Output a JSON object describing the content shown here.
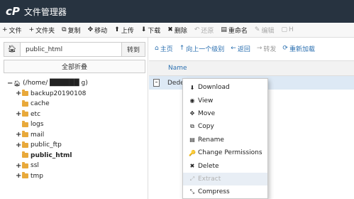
{
  "app": {
    "logo": "cP",
    "title": "文件管理器"
  },
  "toolbar": [
    {
      "icon": "+",
      "label": "文件",
      "disabled": false
    },
    {
      "icon": "+",
      "label": "文件夹",
      "disabled": false
    },
    {
      "icon": "⧉",
      "label": "复制",
      "disabled": false
    },
    {
      "icon": "✥",
      "label": "移动",
      "disabled": false
    },
    {
      "icon": "⬆",
      "label": "上传",
      "disabled": false
    },
    {
      "icon": "⬇",
      "label": "下载",
      "disabled": false
    },
    {
      "icon": "✖",
      "label": "删除",
      "disabled": false
    },
    {
      "icon": "↶",
      "label": "还原",
      "disabled": true
    },
    {
      "icon": "▤",
      "label": "重命名",
      "disabled": false
    },
    {
      "icon": "✎",
      "label": "编辑",
      "disabled": true
    },
    {
      "icon": "▢",
      "label": "H",
      "disabled": true
    }
  ],
  "left": {
    "path_value": "public_html",
    "go_label": "转到",
    "collapse_all": "全部折叠",
    "tree": [
      {
        "pm": "−",
        "label": "(/home/ ██████ g)",
        "home": true,
        "indent": 0,
        "bold": false
      },
      {
        "pm": "+",
        "label": "backup20190108",
        "indent": 1,
        "bold": false
      },
      {
        "pm": "",
        "label": "cache",
        "indent": 1,
        "bold": false
      },
      {
        "pm": "+",
        "label": "etc",
        "indent": 1,
        "bold": false
      },
      {
        "pm": "",
        "label": "logs",
        "indent": 1,
        "bold": false
      },
      {
        "pm": "+",
        "label": "mail",
        "indent": 1,
        "bold": false
      },
      {
        "pm": "+",
        "label": "public_ftp",
        "indent": 1,
        "bold": false
      },
      {
        "pm": "",
        "label": "public_html",
        "indent": 1,
        "bold": true
      },
      {
        "pm": "+",
        "label": "ssl",
        "indent": 1,
        "bold": false
      },
      {
        "pm": "+",
        "label": "tmp",
        "indent": 1,
        "bold": false
      }
    ]
  },
  "right": {
    "nav": [
      {
        "icon": "⌂",
        "label": "主页",
        "disabled": false
      },
      {
        "icon": "↑",
        "label": "向上一个级别",
        "disabled": false
      },
      {
        "icon": "←",
        "label": "返回",
        "disabled": false
      },
      {
        "icon": "→",
        "label": "转发",
        "disabled": true
      },
      {
        "icon": "⟳",
        "label": "重新加载",
        "disabled": false
      }
    ],
    "column_name": "Name",
    "file_name": "Dede"
  },
  "context_menu": [
    {
      "icon": "⬇",
      "label": "Download",
      "disabled": false
    },
    {
      "icon": "◉",
      "label": "View",
      "disabled": false
    },
    {
      "icon": "✥",
      "label": "Move",
      "disabled": false
    },
    {
      "icon": "⧉",
      "label": "Copy",
      "disabled": false
    },
    {
      "icon": "▤",
      "label": "Rename",
      "disabled": false
    },
    {
      "icon": "🔑",
      "label": "Change Permissions",
      "disabled": false
    },
    {
      "icon": "✖",
      "label": "Delete",
      "disabled": false
    },
    {
      "icon": "⤢",
      "label": "Extract",
      "disabled": true
    },
    {
      "icon": "⤡",
      "label": "Compress",
      "disabled": false
    }
  ]
}
